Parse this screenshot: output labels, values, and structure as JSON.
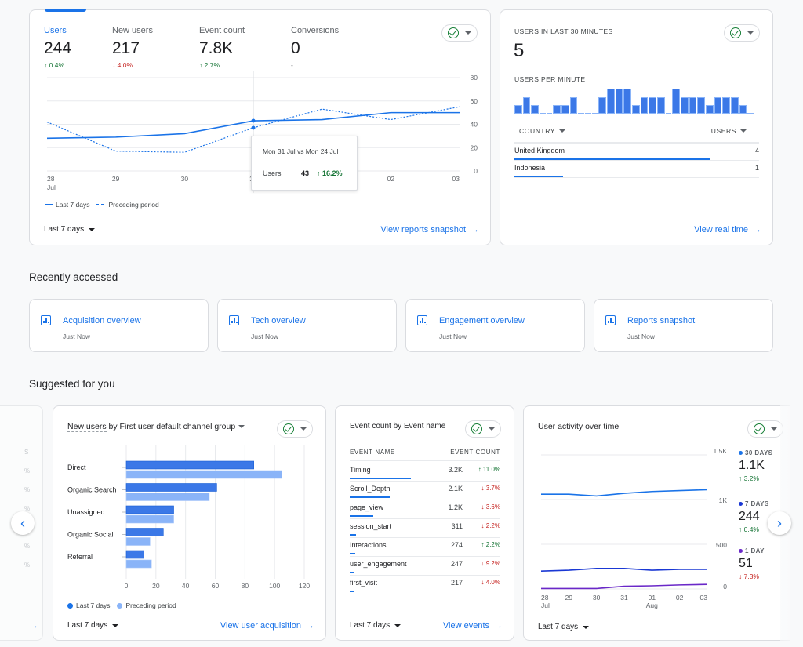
{
  "overview": {
    "kpis": [
      {
        "label": "Users",
        "value": "244",
        "change": "0.4%",
        "direction": "up",
        "active": true
      },
      {
        "label": "New users",
        "value": "217",
        "change": "4.0%",
        "direction": "down"
      },
      {
        "label": "Event count",
        "value": "7.8K",
        "change": "2.7%",
        "direction": "up"
      },
      {
        "label": "Conversions",
        "value": "0",
        "change": "-",
        "direction": "none"
      }
    ],
    "chart_data": {
      "type": "line",
      "x": [
        "28 Jul",
        "29",
        "30",
        "31",
        "01 Aug",
        "02",
        "03"
      ],
      "x_tick_labels": [
        "28",
        "29",
        "30",
        "31",
        "01",
        "02",
        "03"
      ],
      "x_sub_labels": {
        "0": "Jul",
        "4": "Aug"
      },
      "series": [
        {
          "name": "Last 7 days",
          "style": "solid",
          "values": [
            28,
            29,
            32,
            43,
            44,
            50,
            50
          ]
        },
        {
          "name": "Preceding period",
          "style": "dashed",
          "values": [
            42,
            17,
            16,
            37,
            53,
            44,
            55
          ]
        }
      ],
      "y_ticks": [
        0,
        20,
        40,
        60,
        80
      ],
      "ylim": [
        0,
        80
      ],
      "grid": true,
      "legend": "bottom-left"
    },
    "tooltip": {
      "title": "Mon 31 Jul vs Mon 24 Jul",
      "metric": "Users",
      "value": "43",
      "change": "16.2%",
      "direction": "up"
    },
    "legend": [
      "Last 7 days",
      "Preceding period"
    ],
    "date_range": "Last 7 days",
    "link": "View reports snapshot"
  },
  "realtime": {
    "title": "USERS IN LAST 30 MINUTES",
    "value": "5",
    "per_minute_label": "USERS PER MINUTE",
    "per_minute": [
      1,
      2,
      1,
      0,
      0,
      1,
      1,
      2,
      0,
      0,
      0,
      2,
      3,
      3,
      3,
      1,
      2,
      2,
      2,
      0,
      3,
      2,
      2,
      2,
      1,
      2,
      2,
      2,
      1,
      0
    ],
    "table": {
      "col_country": "COUNTRY",
      "col_users": "USERS",
      "rows": [
        {
          "country": "United Kingdom",
          "users": "4",
          "share": 0.8
        },
        {
          "country": "Indonesia",
          "users": "1",
          "share": 0.2
        }
      ]
    },
    "link": "View real time"
  },
  "recent": {
    "heading": "Recently accessed",
    "items": [
      {
        "title": "Acquisition overview",
        "time": "Just Now"
      },
      {
        "title": "Tech overview",
        "time": "Just Now"
      },
      {
        "title": "Engagement overview",
        "time": "Just Now"
      },
      {
        "title": "Reports snapshot",
        "time": "Just Now"
      }
    ]
  },
  "suggested": {
    "heading": "Suggested for you",
    "left_partial": {
      "items": [
        "S",
        "%",
        "%",
        "%",
        "%",
        "%",
        "%"
      ]
    },
    "acquisition": {
      "title_part1": "New users",
      "title_part2": " by First user default channel group",
      "chart_data": {
        "type": "bar",
        "orientation": "horizontal",
        "categories": [
          "Direct",
          "Organic Search",
          "Unassigned",
          "Organic Social",
          "Referral"
        ],
        "series": [
          {
            "name": "Last 7 days",
            "values": [
              86,
              61,
              32,
              25,
              12
            ]
          },
          {
            "name": "Preceding period",
            "values": [
              105,
              56,
              32,
              16,
              17
            ]
          }
        ],
        "x_ticks": [
          0,
          20,
          40,
          60,
          80,
          100,
          120
        ],
        "xlim": [
          0,
          120
        ],
        "grid": true,
        "legend": "bottom-left"
      },
      "legend": [
        "Last 7 days",
        "Preceding period"
      ],
      "date_range": "Last 7 days",
      "link": "View user acquisition"
    },
    "events": {
      "title_part1": "Event count",
      "title_part2": " by ",
      "title_part3": "Event name",
      "col_name": "EVENT NAME",
      "col_count": "EVENT COUNT",
      "rows": [
        {
          "name": "Timing",
          "count": "3.2K",
          "change": "11.0%",
          "direction": "up",
          "share": 1.0
        },
        {
          "name": "Scroll_Depth",
          "count": "2.1K",
          "change": "3.7%",
          "direction": "down",
          "share": 0.66
        },
        {
          "name": "page_view",
          "count": "1.2K",
          "change": "3.6%",
          "direction": "down",
          "share": 0.38
        },
        {
          "name": "session_start",
          "count": "311",
          "change": "2.2%",
          "direction": "down",
          "share": 0.1
        },
        {
          "name": "Interactions",
          "count": "274",
          "change": "2.2%",
          "direction": "up",
          "share": 0.09
        },
        {
          "name": "user_engagement",
          "count": "247",
          "change": "9.2%",
          "direction": "down",
          "share": 0.08
        },
        {
          "name": "first_visit",
          "count": "217",
          "change": "4.0%",
          "direction": "down",
          "share": 0.07
        }
      ],
      "date_range": "Last 7 days",
      "link": "View events"
    },
    "activity": {
      "title": "User activity over time",
      "chart_data": {
        "type": "line",
        "x": [
          "28 Jul",
          "29",
          "30",
          "31",
          "01 Aug",
          "02",
          "03"
        ],
        "x_tick_labels": [
          "28",
          "29",
          "30",
          "31",
          "01",
          "02",
          "03"
        ],
        "x_sub_labels": {
          "0": "Jul",
          "4": "Aug"
        },
        "series": [
          {
            "name": "30 DAYS",
            "color": "#1a73e8",
            "values": [
              1060,
              1060,
              1040,
              1070,
              1090,
              1100,
              1110
            ]
          },
          {
            "name": "7 DAYS",
            "color": "#1a38d4",
            "values": [
              200,
              210,
              230,
              230,
              210,
              220,
              220
            ]
          },
          {
            "name": "1 DAY",
            "color": "#6a28c8",
            "values": [
              5,
              5,
              5,
              30,
              35,
              45,
              51
            ]
          }
        ],
        "y_ticks": [
          "0",
          "500",
          "1K",
          "1.5K"
        ],
        "y_tick_values": [
          0,
          500,
          1000,
          1500
        ],
        "ylim": [
          0,
          1500
        ],
        "grid": true,
        "legend": "right"
      },
      "summary": [
        {
          "label": "30 DAYS",
          "value": "1.1K",
          "change": "3.2%",
          "direction": "up",
          "color": "#1a73e8"
        },
        {
          "label": "7 DAYS",
          "value": "244",
          "change": "0.4%",
          "direction": "up",
          "color": "#1a38d4"
        },
        {
          "label": "1 DAY",
          "value": "51",
          "change": "7.3%",
          "direction": "down",
          "color": "#6a28c8"
        }
      ],
      "date_range": "Last 7 days"
    }
  },
  "arrows": {
    "up": "↑",
    "down": "↓",
    "right": "→",
    "prev": "‹",
    "next": "›"
  }
}
